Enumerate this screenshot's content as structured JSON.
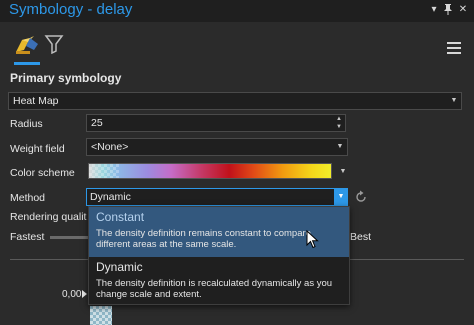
{
  "window": {
    "title": "Symbology - delay",
    "controls": {
      "pin_icon": "pin-icon",
      "close_icon": "close-icon",
      "menu_icon": "dropdown-arrow-icon"
    }
  },
  "toolbar": {
    "tabs": [
      {
        "name": "primary-symbology-tab",
        "icon": "paint-brush-icon",
        "active": true
      },
      {
        "name": "masking-tab",
        "icon": "funnel-icon",
        "active": false
      }
    ],
    "menu_icon": "hamburger-menu-icon"
  },
  "primary_symbology": {
    "section_title": "Primary symbology",
    "renderer": "Heat Map",
    "radius": {
      "label": "Radius",
      "value": "25"
    },
    "weight_field": {
      "label": "Weight field",
      "value": "<None>"
    },
    "color_scheme": {
      "label": "Color scheme",
      "colors": [
        "#d8d8d8",
        "#9ad7df",
        "#9c8ce0",
        "#c53b6a",
        "#c1111a",
        "#f19a10",
        "#f2ee2a"
      ]
    },
    "method": {
      "label": "Method",
      "value": "Dynamic"
    },
    "rendering_quality": {
      "label": "Rendering qualit",
      "min_label": "Fastest",
      "max_label": "Best"
    }
  },
  "method_dropdown": {
    "options": [
      {
        "title": "Constant",
        "desc_line1": "The density definition remains constant to compare",
        "desc_line2": "different areas at the same scale.",
        "highlighted": true
      },
      {
        "title": "Dynamic",
        "desc_line1": "The density definition is recalculated dynamically as you",
        "desc_line2": "change scale and extent.",
        "highlighted": false
      }
    ]
  },
  "legend": {
    "first_value": "0,00"
  },
  "accent_color": "#2d98e8"
}
